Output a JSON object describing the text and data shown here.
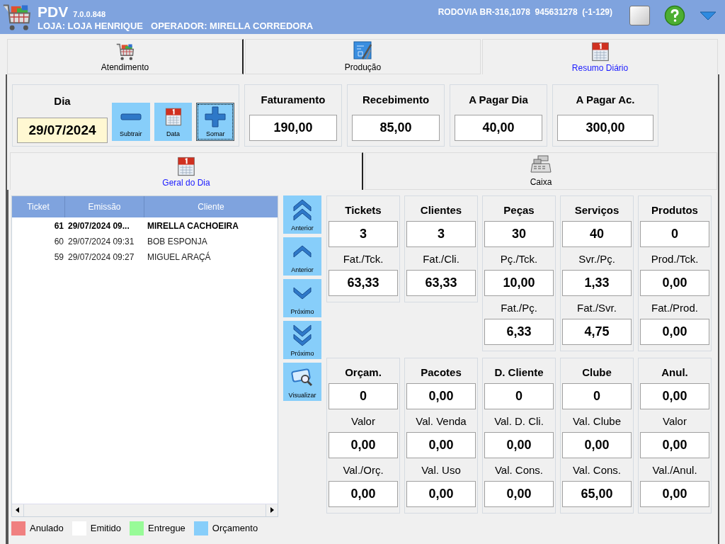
{
  "header": {
    "title": "PDV",
    "version": "7.0.0.848",
    "store": "LOJA: LOJA HENRIQUE",
    "operator": "OPERADOR: MIRELLA CORREDORA",
    "address": "RODOVIA BR-316,1078  945631278  (-1-129)"
  },
  "main_tabs": [
    {
      "label": "Atendimento",
      "kind": "cart",
      "selected": false
    },
    {
      "label": "Produção",
      "kind": "blueprint",
      "selected": false
    },
    {
      "label": "Resumo Diário",
      "kind": "calendar",
      "selected": true
    }
  ],
  "day": {
    "label": "Dia",
    "value": "29/07/2024",
    "buttons": [
      {
        "label": "Subtrair",
        "kind": "minus",
        "focused": false
      },
      {
        "label": "Data",
        "kind": "calendar",
        "focused": false
      },
      {
        "label": "Somar",
        "kind": "plus",
        "focused": true
      }
    ]
  },
  "totals": [
    {
      "label": "Faturamento",
      "value": "190,00"
    },
    {
      "label": "Recebimento",
      "value": "85,00"
    },
    {
      "label": "A Pagar Dia",
      "value": "40,00"
    },
    {
      "label": "A Pagar Ac.",
      "value": "300,00"
    }
  ],
  "sub_tabs": [
    {
      "label": "Geral do Dia",
      "kind": "calendar",
      "selected": true
    },
    {
      "label": "Caixa",
      "kind": "register",
      "selected": false
    }
  ],
  "tickets": {
    "columns": [
      "Ticket",
      "Emissão",
      "Cliente"
    ],
    "rows": [
      {
        "ticket": "61",
        "emissao": "29/07/2024 09...",
        "cliente": "MIRELLA CACHOEIRA",
        "selected": true
      },
      {
        "ticket": "60",
        "emissao": "29/07/2024 09:31",
        "cliente": "BOB ESPONJA",
        "selected": false
      },
      {
        "ticket": "59",
        "emissao": "29/07/2024 09:27",
        "cliente": "MIGUEL ARAÇÁ",
        "selected": false
      }
    ]
  },
  "nav_buttons": [
    {
      "label": "Anterior",
      "kind": "first"
    },
    {
      "label": "Anterior",
      "kind": "prev"
    },
    {
      "label": "Próximo",
      "kind": "next"
    },
    {
      "label": "Próximo",
      "kind": "last"
    },
    {
      "label": "Visualizar",
      "kind": "view"
    }
  ],
  "stats": [
    [
      {
        "fields": [
          {
            "label": "Tickets",
            "value": "3"
          },
          {
            "label": "Fat./Tck.",
            "value": "63,33"
          }
        ]
      },
      {
        "fields": [
          {
            "label": "Clientes",
            "value": "3"
          },
          {
            "label": "Fat./Cli.",
            "value": "63,33"
          }
        ]
      },
      {
        "fields": [
          {
            "label": "Peças",
            "value": "30"
          },
          {
            "label": "Pç./Tck.",
            "value": "10,00"
          },
          {
            "label": "Fat./Pç.",
            "value": "6,33"
          }
        ]
      },
      {
        "fields": [
          {
            "label": "Serviços",
            "value": "40"
          },
          {
            "label": "Svr./Pç.",
            "value": "1,33"
          },
          {
            "label": "Fat./Svr.",
            "value": "4,75"
          }
        ]
      },
      {
        "fields": [
          {
            "label": "Produtos",
            "value": "0"
          },
          {
            "label": "Prod./Tck.",
            "value": "0,00"
          },
          {
            "label": "Fat./Prod.",
            "value": "0,00"
          }
        ]
      }
    ],
    [
      {
        "fields": [
          {
            "label": "Orçam.",
            "value": "0"
          },
          {
            "label": "Valor",
            "value": "0,00"
          },
          {
            "label": "Val./Orç.",
            "value": "0,00"
          }
        ]
      },
      {
        "fields": [
          {
            "label": "Pacotes",
            "value": "0,00"
          },
          {
            "label": "Val. Venda",
            "value": "0,00"
          },
          {
            "label": "Val. Uso",
            "value": "0,00"
          }
        ]
      },
      {
        "fields": [
          {
            "label": "D. Cliente",
            "value": "0"
          },
          {
            "label": "Val. D. Cli.",
            "value": "0,00"
          },
          {
            "label": "Val. Cons.",
            "value": "0,00"
          }
        ]
      },
      {
        "fields": [
          {
            "label": "Clube",
            "value": "0"
          },
          {
            "label": "Val. Clube",
            "value": "0,00"
          },
          {
            "label": "Val. Cons.",
            "value": "65,00"
          }
        ]
      },
      {
        "fields": [
          {
            "label": "Anul.",
            "value": "0,00"
          },
          {
            "label": "Valor",
            "value": "0,00"
          },
          {
            "label": "Val./Anul.",
            "value": "0,00"
          }
        ]
      }
    ]
  ],
  "legend": [
    {
      "label": "Anulado",
      "color": "#f08080"
    },
    {
      "label": "Emitido",
      "color": "#ffffff"
    },
    {
      "label": "Entregue",
      "color": "#98fb98"
    },
    {
      "label": "Orçamento",
      "color": "#87cefa"
    }
  ]
}
